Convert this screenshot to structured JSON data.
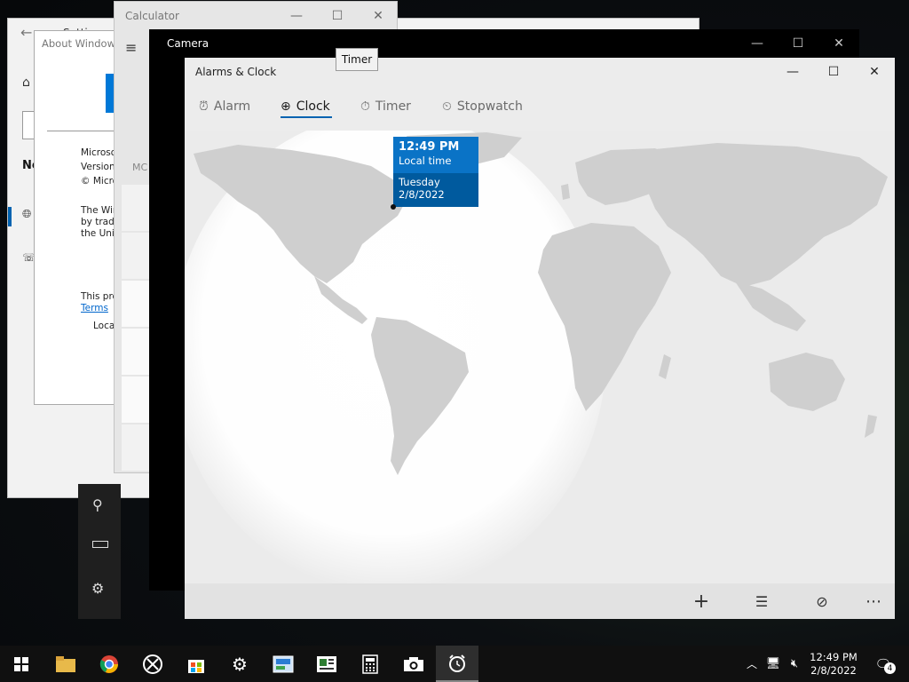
{
  "tooltip": "Timer",
  "settings": {
    "title": "Settin",
    "nav_label": "Ne"
  },
  "about": {
    "title": "About Windows",
    "lines": [
      "Microso",
      "Version",
      "© Micro",
      "The Win",
      "by trade",
      "the Unit",
      "This pro",
      "Terms",
      "Loca"
    ]
  },
  "calculator": {
    "title": "Calculator",
    "mode_fragment": "MC"
  },
  "camera": {
    "title": "Camera"
  },
  "alarms": {
    "title": "Alarms & Clock",
    "tabs": [
      {
        "label": "Alarm",
        "icon": "alarm-icon"
      },
      {
        "label": "Clock",
        "icon": "globe-clock-icon"
      },
      {
        "label": "Timer",
        "icon": "timer-icon"
      },
      {
        "label": "Stopwatch",
        "icon": "stopwatch-icon"
      }
    ],
    "active_tab": "Clock",
    "local_pin": {
      "time": "12:49 PM",
      "label": "Local time",
      "day": "Tuesday",
      "date": "2/8/2022"
    },
    "bottom_actions": [
      "add-icon",
      "select-list-icon",
      "compare-clocks-icon",
      "more-icon"
    ]
  },
  "taskbar": {
    "apps": [
      "start",
      "file-explorer",
      "chrome",
      "xbox",
      "store",
      "settings",
      "control-panel",
      "news",
      "calculator",
      "camera",
      "alarms-clock"
    ],
    "clock_time": "12:49 PM",
    "clock_date": "2/8/2022",
    "notification_count": "4"
  },
  "colors": {
    "accent": "#0063b1",
    "pin_top": "#0a73c6",
    "pin_bottom": "#005a9e",
    "taskbar": "#101010"
  }
}
